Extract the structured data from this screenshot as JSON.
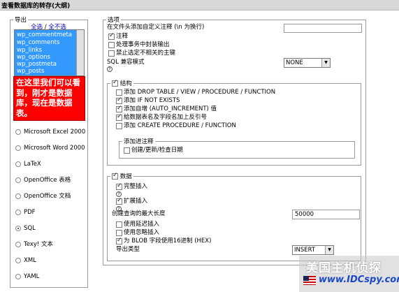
{
  "page_title": "查看数据库的转存(大纲)",
  "export": {
    "legend": "导出",
    "select_all": "全选",
    "separator": "/",
    "select_none": "全不选",
    "tables": [
      "wp_commentmeta",
      "wp_comments",
      "wp_links",
      "wp_options",
      "wp_postmeta",
      "wp_posts"
    ],
    "annotation": "在这里我们可以看到，刚才是数据库，现在是数据表。",
    "formats": [
      {
        "label": "Microsoft Excel 2000",
        "checked": false
      },
      {
        "label": "Microsoft Word 2000",
        "checked": false
      },
      {
        "label": "LaTeX",
        "checked": false
      },
      {
        "label": "OpenOffice 表格",
        "checked": false
      },
      {
        "label": "OpenOffice 文档",
        "checked": false
      },
      {
        "label": "PDF",
        "checked": false
      },
      {
        "label": "SQL",
        "checked": true
      },
      {
        "label": "Texy! 文本",
        "checked": false
      },
      {
        "label": "XML",
        "checked": false
      },
      {
        "label": "YAML",
        "checked": false
      }
    ]
  },
  "options": {
    "legend": "选项",
    "header_comment_label": "在文件头添加自定义注释 (\\n 为换行)",
    "header_comment_value": "",
    "comments": {
      "label": "注释",
      "checked": true
    },
    "transaction": {
      "label": "处理事务中封装输出",
      "checked": false
    },
    "disable_fk": {
      "label": "禁止选定不相关的主键",
      "checked": false
    },
    "sql_compat_label": "SQL 兼容模式",
    "sql_compat_value": "NONE",
    "structure": {
      "legend": "结构",
      "checked": true,
      "items": [
        {
          "label": "添加 DROP TABLE / VIEW / PROCEDURE / FUNCTION",
          "checked": false
        },
        {
          "label": "添加 IF NOT EXISTS",
          "checked": true
        },
        {
          "label": "添加自增 (AUTO_INCREMENT) 值",
          "checked": true
        },
        {
          "label": "給数据表名及字段名加上反引号",
          "checked": true
        },
        {
          "label": "添加 CREATE PROCEDURE / FUNCTION",
          "checked": false
        }
      ],
      "add_comments_legend": "添加进注释",
      "add_comments_items": [
        {
          "label": "创建/更新/检查日期",
          "checked": false
        }
      ]
    },
    "data": {
      "legend": "数据",
      "checked": true,
      "complete_insert": {
        "label": "完整插入",
        "checked": true
      },
      "extended_insert": {
        "label": "扩展插入",
        "checked": true
      },
      "max_query_label": "创建查询的最大长度",
      "max_query_value": "50000",
      "delayed_insert": {
        "label": "使用延迟插入",
        "checked": false
      },
      "ignore_insert": {
        "label": "使用忽略插入",
        "checked": false
      },
      "hex_blob": {
        "label": "为 BLOB 字段使用16进制 (HEX)",
        "checked": true
      },
      "export_type_label": "导出类型",
      "export_type_value": "INSERT"
    }
  },
  "help_icon": "?",
  "watermark": {
    "line1": "美国主机侦探",
    "line2": "www.IDCspy.com"
  }
}
